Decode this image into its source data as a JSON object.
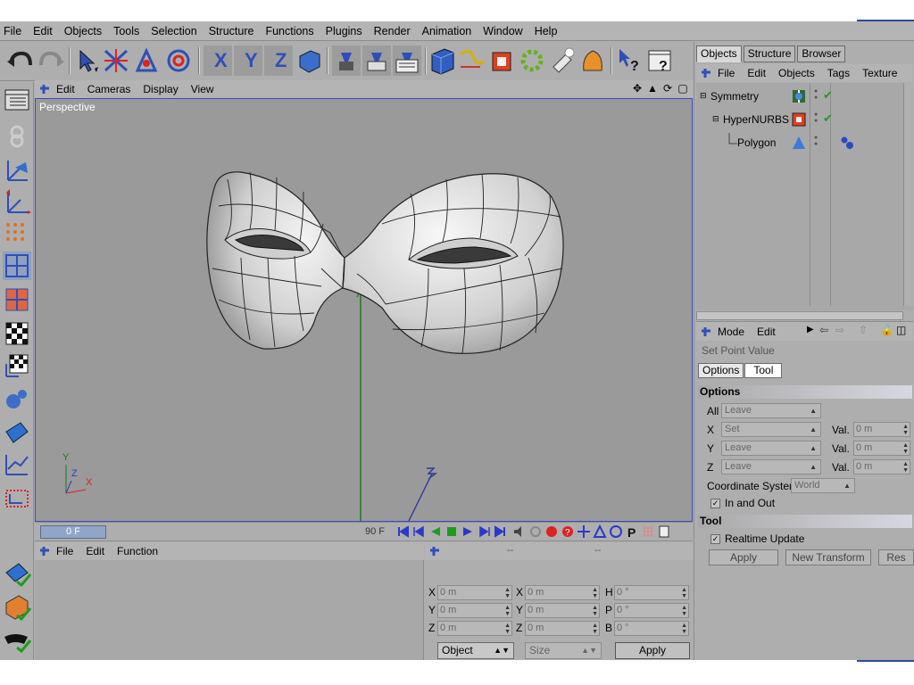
{
  "menubar": [
    "File",
    "Edit",
    "Objects",
    "Tools",
    "Selection",
    "Structure",
    "Functions",
    "Plugins",
    "Render",
    "Animation",
    "Window",
    "Help"
  ],
  "viewport": {
    "menu": [
      "Edit",
      "Cameras",
      "Display",
      "View"
    ],
    "label": "Perspective",
    "axis_y": "Y",
    "axis_z": "Z",
    "axis_x": "X"
  },
  "timeline": {
    "current_frame": "0 F",
    "end_frame": "90 F"
  },
  "material": {
    "menu": [
      "File",
      "Edit",
      "Function"
    ]
  },
  "coords": {
    "header_dashes": [
      "--",
      "--",
      "--"
    ],
    "rows": [
      {
        "l1": "X",
        "v1": "0 m",
        "l2": "X",
        "v2": "0 m",
        "l3": "H",
        "v3": "0 °"
      },
      {
        "l1": "Y",
        "v1": "0 m",
        "l2": "Y",
        "v2": "0 m",
        "l3": "P",
        "v3": "0 °"
      },
      {
        "l1": "Z",
        "v1": "0 m",
        "l2": "Z",
        "v2": "0 m",
        "l3": "B",
        "v3": "0 °"
      }
    ],
    "mode_select": "Object",
    "size_select": "Size",
    "apply": "Apply"
  },
  "objects": {
    "tabs": [
      "Objects",
      "Structure",
      "Browser"
    ],
    "menu": [
      "File",
      "Edit",
      "Objects",
      "Tags",
      "Texture"
    ],
    "items": [
      {
        "name": "Symmetry"
      },
      {
        "name": "HyperNURBS"
      },
      {
        "name": "Polygon"
      }
    ]
  },
  "attributes": {
    "menu": [
      "Mode",
      "Edit"
    ],
    "tool_name": "Set Point Value",
    "tabs": [
      "Options",
      "Tool"
    ],
    "options_title": "Options",
    "rows": [
      {
        "label": "All",
        "value": "Leave"
      },
      {
        "label": "X",
        "value": "Set",
        "val_label": "Val.",
        "val": "0 m"
      },
      {
        "label": "Y",
        "value": "Leave",
        "val_label": "Val.",
        "val": "0 m"
      },
      {
        "label": "Z",
        "value": "Leave",
        "val_label": "Val.",
        "val": "0 m"
      }
    ],
    "coord_label": "Coordinate System",
    "coord_value": "World",
    "in_and_out": "In and Out",
    "tool_title": "Tool",
    "realtime": "Realtime Update",
    "btn_apply": "Apply",
    "btn_new_transform": "New Transform",
    "btn_reset": "Res"
  },
  "colors": {
    "viewport_bg": "#9a9a9a",
    "accent_blue": "#3b4bc8",
    "check_green": "#1d9c1d"
  }
}
